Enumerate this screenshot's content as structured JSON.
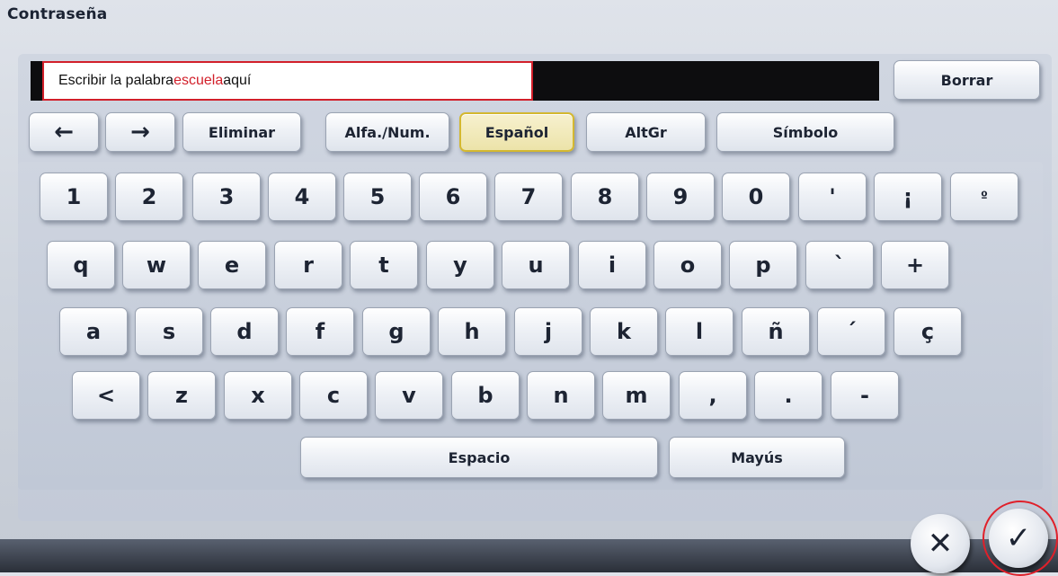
{
  "title": "Contraseña",
  "input": {
    "before": "Escribir la palabra ",
    "highlight": "escuela",
    "after": " aquí"
  },
  "toolbar": {
    "clear": "Borrar",
    "left_arrow": "←",
    "right_arrow": "→",
    "delete": "Eliminar",
    "alphanum": "Alfa./Num.",
    "spanish": "Español",
    "altgr": "AltGr",
    "symbol": "Símbolo"
  },
  "rows": {
    "r1": [
      "1",
      "2",
      "3",
      "4",
      "5",
      "6",
      "7",
      "8",
      "9",
      "0",
      "'",
      "¡",
      "º"
    ],
    "r2": [
      "q",
      "w",
      "e",
      "r",
      "t",
      "y",
      "u",
      "i",
      "o",
      "p",
      "`",
      "+"
    ],
    "r3": [
      "a",
      "s",
      "d",
      "f",
      "g",
      "h",
      "j",
      "k",
      "l",
      "ñ",
      "´",
      "ç"
    ],
    "r4": [
      "<",
      "z",
      "x",
      "c",
      "v",
      "b",
      "n",
      "m",
      ",",
      ".",
      "-"
    ]
  },
  "bottom": {
    "space": "Espacio",
    "shift": "Mayús"
  },
  "actions": {
    "cancel": "✕",
    "ok": "✓"
  },
  "colors": {
    "highlight": "#d21f2a",
    "selected_border": "#d4b830"
  }
}
